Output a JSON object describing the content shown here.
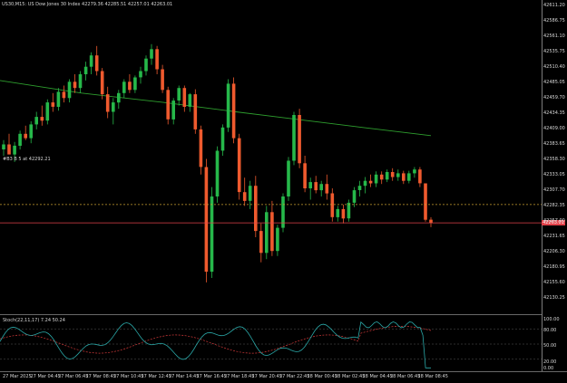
{
  "header": {
    "title": "US30,M15:  US Dow Jones 30 Index  42279.36 42285.51 42257.01 42263.01"
  },
  "order_line_label": "#B3 B 5 at 42292.21",
  "price_axis": {
    "labels": [
      "42611.20",
      "42586.75",
      "42561.10",
      "42535.75",
      "42510.40",
      "42485.05",
      "42459.70",
      "42434.35",
      "42409.00",
      "42383.65",
      "42358.30",
      "42333.05",
      "42307.70",
      "42282.35",
      "42257.00",
      "42231.65",
      "42206.30",
      "42180.95",
      "42155.60",
      "42130.25"
    ],
    "current_price": "42263.01"
  },
  "stoch": {
    "label": "Stoch(22,11,17) 7.24 50.24",
    "axis_labels": [
      "100.00",
      "80.00",
      "50.00",
      "20.00",
      "0.00"
    ]
  },
  "time_axis": {
    "labels": [
      "27 Mar 2025",
      "27 Mar 04:45",
      "27 Mar 06:45",
      "27 Mar 08:45",
      "27 Mar 10:45",
      "27 Mar 12:45",
      "27 Mar 14:45",
      "27 Mar 16:45",
      "27 Mar 18:45",
      "27 Mar 20:45",
      "27 Mar 22:45",
      "28 Mar 00:45",
      "28 Mar 02:45",
      "28 Mar 04:45",
      "28 Mar 06:45",
      "28 Mar 08:45"
    ]
  },
  "colors": {
    "background": "#000000",
    "bull": "#26b84a",
    "bear": "#ef5a2e",
    "moving_average": "#2e9e2e",
    "order_line": "#c8a030",
    "bid_line": "#e2424a",
    "stoch_main": "#2aa8a8",
    "stoch_signal": "#d43a3a",
    "grid": "#5a5a5a"
  },
  "chart_data": {
    "type": "candlestick",
    "timeframe": "M15",
    "symbol": "US30",
    "order_line_price": 42292.21,
    "bid_price": 42263.01,
    "candles": [
      [
        42380,
        42395,
        42370,
        42388
      ],
      [
        42388,
        42405,
        42378,
        42372
      ],
      [
        42372,
        42392,
        42360,
        42386
      ],
      [
        42386,
        42410,
        42380,
        42405
      ],
      [
        42405,
        42418,
        42395,
        42398
      ],
      [
        42398,
        42425,
        42390,
        42420
      ],
      [
        42420,
        42440,
        42412,
        42432
      ],
      [
        42432,
        42450,
        42418,
        42426
      ],
      [
        42426,
        42460,
        42420,
        42455
      ],
      [
        42455,
        42470,
        42440,
        42448
      ],
      [
        42448,
        42478,
        42442,
        42472
      ],
      [
        42472,
        42482,
        42455,
        42462
      ],
      [
        42462,
        42492,
        42455,
        42488
      ],
      [
        42488,
        42500,
        42470,
        42478
      ],
      [
        42478,
        42505,
        42470,
        42500
      ],
      [
        42500,
        42520,
        42490,
        42512
      ],
      [
        42512,
        42535,
        42500,
        42530
      ],
      [
        42530,
        42545,
        42498,
        42505
      ],
      [
        42505,
        42510,
        42460,
        42468
      ],
      [
        42468,
        42480,
        42430,
        42440
      ],
      [
        42440,
        42462,
        42420,
        42455
      ],
      [
        42455,
        42475,
        42445,
        42470
      ],
      [
        42470,
        42492,
        42462,
        42488
      ],
      [
        42488,
        42500,
        42470,
        42475
      ],
      [
        42475,
        42498,
        42470,
        42495
      ],
      [
        42495,
        42512,
        42485,
        42505
      ],
      [
        42505,
        42530,
        42498,
        42525
      ],
      [
        42525,
        42548,
        42515,
        42540
      ],
      [
        42540,
        42545,
        42500,
        42508
      ],
      [
        42508,
        42515,
        42470,
        42475
      ],
      [
        42475,
        42480,
        42420,
        42428
      ],
      [
        42428,
        42462,
        42420,
        42458
      ],
      [
        42458,
        42482,
        42450,
        42478
      ],
      [
        42478,
        42482,
        42440,
        42448
      ],
      [
        42448,
        42470,
        42440,
        42468
      ],
      [
        42468,
        42476,
        42405,
        42412
      ],
      [
        42412,
        42418,
        42340,
        42352
      ],
      [
        42352,
        42365,
        42168,
        42185
      ],
      [
        42185,
        42320,
        42175,
        42305
      ],
      [
        42305,
        42385,
        42295,
        42378
      ],
      [
        42378,
        42420,
        42370,
        42415
      ],
      [
        42415,
        42492,
        42408,
        42485
      ],
      [
        42485,
        42495,
        42390,
        42398
      ],
      [
        42398,
        42405,
        42300,
        42312
      ],
      [
        42312,
        42335,
        42290,
        42298
      ],
      [
        42298,
        42330,
        42285,
        42322
      ],
      [
        42322,
        42338,
        42240,
        42250
      ],
      [
        42250,
        42262,
        42200,
        42215
      ],
      [
        42215,
        42290,
        42205,
        42280
      ],
      [
        42280,
        42298,
        42210,
        42218
      ],
      [
        42218,
        42260,
        42210,
        42255
      ],
      [
        42255,
        42310,
        42248,
        42305
      ],
      [
        42305,
        42368,
        42298,
        42362
      ],
      [
        42362,
        42440,
        42355,
        42435
      ],
      [
        42435,
        42445,
        42350,
        42358
      ],
      [
        42358,
        42370,
        42312,
        42318
      ],
      [
        42318,
        42335,
        42300,
        42328
      ],
      [
        42328,
        42338,
        42310,
        42315
      ],
      [
        42315,
        42330,
        42305,
        42325
      ],
      [
        42325,
        42340,
        42300,
        42310
      ],
      [
        42310,
        42318,
        42265,
        42272
      ],
      [
        42272,
        42290,
        42265,
        42285
      ],
      [
        42285,
        42292,
        42262,
        42270
      ],
      [
        42270,
        42300,
        42265,
        42295
      ],
      [
        42295,
        42320,
        42288,
        42315
      ],
      [
        42315,
        42330,
        42305,
        42322
      ],
      [
        42322,
        42336,
        42310,
        42330
      ],
      [
        42330,
        42340,
        42320,
        42326
      ],
      [
        42326,
        42345,
        42320,
        42340
      ],
      [
        42340,
        42345,
        42325,
        42332
      ],
      [
        42332,
        42348,
        42328,
        42344
      ],
      [
        42344,
        42350,
        42330,
        42336
      ],
      [
        42336,
        42348,
        42330,
        42342
      ],
      [
        42342,
        42346,
        42325,
        42330
      ],
      [
        42330,
        42346,
        42326,
        42342
      ],
      [
        42342,
        42352,
        42335,
        42348
      ],
      [
        42348,
        42352,
        42320,
        42326
      ],
      [
        42326,
        42308,
        42265,
        42268
      ],
      [
        42268,
        42272,
        42256,
        42263
      ]
    ],
    "moving_average": [
      42490,
      42470,
      42455,
      42440,
      42415,
      42402
    ]
  }
}
